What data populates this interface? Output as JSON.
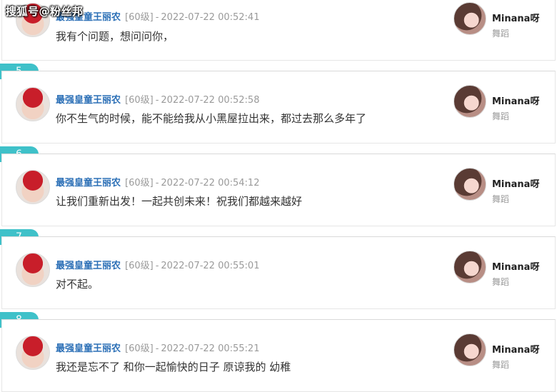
{
  "watermark": "搜狐号@粉丝邦",
  "items": [
    {
      "floor": "",
      "user": "最强皇童王丽农",
      "level": "[60级]",
      "sep": "-",
      "time": "2022-07-22 00:52:41",
      "message": "我有个问题，想问问你，",
      "right_user": "Minana呀",
      "right_role": "舞蹈"
    },
    {
      "floor": "5",
      "user": "最强皇童王丽农",
      "level": "[60级]",
      "sep": "-",
      "time": "2022-07-22 00:52:58",
      "message": "你不生气的时候，能不能给我从小黑屋拉出来，都过去那么多年了",
      "right_user": "Minana呀",
      "right_role": "舞蹈"
    },
    {
      "floor": "6",
      "user": "最强皇童王丽农",
      "level": "[60级]",
      "sep": "-",
      "time": "2022-07-22 00:54:12",
      "message": "让我们重新出发！一起共创未来！祝我们都越来越好",
      "right_user": "Minana呀",
      "right_role": "舞蹈"
    },
    {
      "floor": "7",
      "user": "最强皇童王丽农",
      "level": "[60级]",
      "sep": "-",
      "time": "2022-07-22 00:55:01",
      "message": "对不起。",
      "right_user": "Minana呀",
      "right_role": "舞蹈"
    },
    {
      "floor": "8",
      "user": "最强皇童王丽农",
      "level": "[60级]",
      "sep": "-",
      "time": "2022-07-22 00:55:21",
      "message": "我还是忘不了 和你一起愉快的日子 原谅我的 幼稚",
      "right_user": "Minana呀",
      "right_role": "舞蹈"
    }
  ]
}
